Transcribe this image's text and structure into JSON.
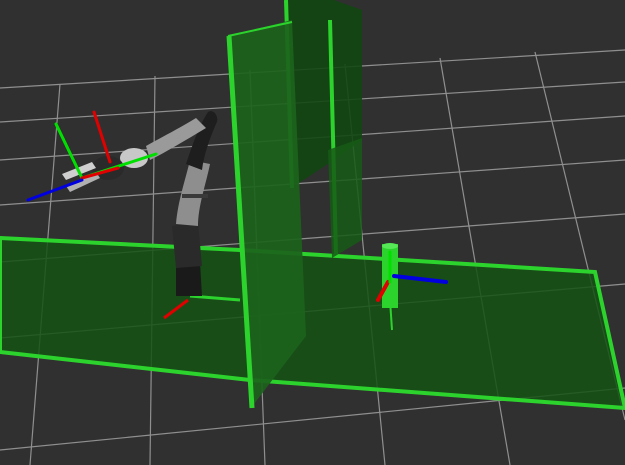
{
  "scene": {
    "background": "#303030",
    "grid_color": "#a0a0a0",
    "collision_green": "#2dd32d",
    "collision_green_dark": "#165a16",
    "arm_color": "#8e8e8e",
    "axis_colors": {
      "x": "#e00000",
      "y": "#00e000",
      "z": "#0000e0"
    },
    "objects": {
      "floor": "floor-plane",
      "wall_front": "front-wall-panel",
      "wall_back": "back-wall-panel",
      "cylinder": "target-cylinder",
      "robot": "robot-arm"
    }
  }
}
